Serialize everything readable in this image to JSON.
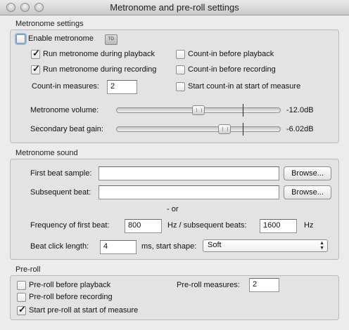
{
  "window": {
    "title": "Metronome and pre-roll settings"
  },
  "metronome_settings": {
    "section_label": "Metronome settings",
    "enable_metronome": {
      "label": "Enable metronome",
      "checked": false
    },
    "to_button_label": "TO",
    "run_during_playback": {
      "label": "Run metronome during playback",
      "checked": true
    },
    "run_during_recording": {
      "label": "Run metronome during recording",
      "checked": true
    },
    "countin_before_playback": {
      "label": "Count-in before playback",
      "checked": false
    },
    "countin_before_recording": {
      "label": "Count-in before recording",
      "checked": false
    },
    "countin_measures": {
      "label": "Count-in measures:",
      "value": "2"
    },
    "start_countin_at_measure": {
      "label": "Start count-in at start of measure",
      "checked": false
    },
    "metronome_volume": {
      "label": "Metronome volume:",
      "value_text": "-12.0dB",
      "fraction": 0.5
    },
    "secondary_beat_gain": {
      "label": "Secondary beat gain:",
      "value_text": "-6.02dB",
      "fraction": 0.67
    }
  },
  "metronome_sound": {
    "section_label": "Metronome sound",
    "first_beat_sample": {
      "label": "First beat sample:",
      "value": "",
      "browse_label": "Browse..."
    },
    "subsequent_beat": {
      "label": "Subsequent beat:",
      "value": "",
      "browse_label": "Browse..."
    },
    "or_text": "- or",
    "freq_first_beat": {
      "label": "Frequency of first beat:",
      "value": "800",
      "unit_text": "Hz / subsequent beats:"
    },
    "freq_subsequent": {
      "value": "1600",
      "unit_text": "Hz"
    },
    "beat_click_length": {
      "label": "Beat click length:",
      "value": "4",
      "unit_text": "ms, start shape:"
    },
    "start_shape": {
      "selected": "Soft"
    }
  },
  "preroll": {
    "section_label": "Pre-roll",
    "preroll_before_playback": {
      "label": "Pre-roll before playback",
      "checked": false
    },
    "preroll_before_recording": {
      "label": "Pre-roll before recording",
      "checked": false
    },
    "start_preroll_at_measure": {
      "label": "Start pre-roll at start of measure",
      "checked": true
    },
    "preroll_measures": {
      "label": "Pre-roll measures:",
      "value": "2"
    }
  }
}
